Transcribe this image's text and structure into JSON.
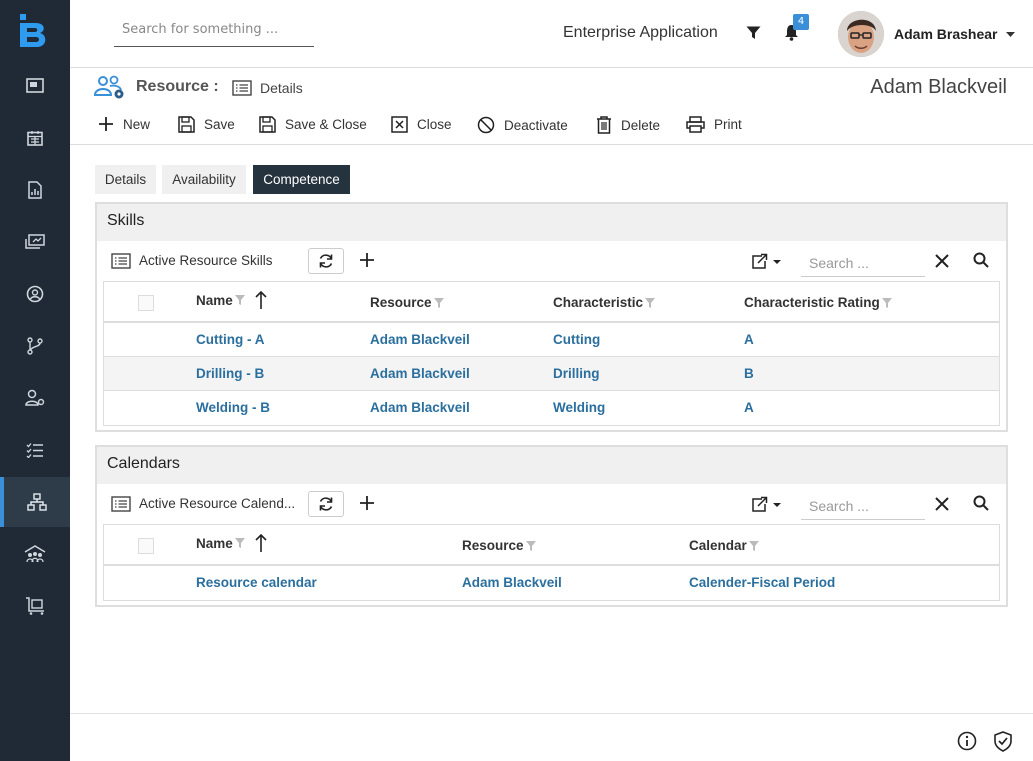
{
  "topbar": {
    "search_placeholder": "Search for something ...",
    "app_name": "Enterprise Application",
    "notification_count": "4",
    "user_name": "Adam Brashear"
  },
  "titlebar": {
    "entity_label": "Resource :",
    "view_label": "Details",
    "record_name": "Adam Blackveil"
  },
  "toolbar": {
    "new": "New",
    "save": "Save",
    "save_close": "Save & Close",
    "close": "Close",
    "deactivate": "Deactivate",
    "delete": "Delete",
    "print": "Print"
  },
  "tabs": [
    "Details",
    "Availability",
    "Competence"
  ],
  "skills": {
    "title": "Skills",
    "view_name": "Active Resource Skills",
    "search_placeholder": "Search ...",
    "columns": [
      "Name",
      "Resource",
      "Characteristic",
      "Characteristic Rating"
    ],
    "rows": [
      [
        "Cutting - A",
        "Adam Blackveil",
        "Cutting",
        "A"
      ],
      [
        "Drilling - B",
        "Adam Blackveil",
        "Drilling",
        "B"
      ],
      [
        "Welding - B",
        "Adam Blackveil",
        "Welding",
        "A"
      ]
    ]
  },
  "calendars": {
    "title": "Calendars",
    "view_name": "Active Resource Calend...",
    "search_placeholder": "Search ...",
    "columns": [
      "Name",
      "Resource",
      "Calendar"
    ],
    "rows": [
      [
        "Resource calendar",
        "Adam Blackveil",
        "Calender-Fiscal Period"
      ]
    ]
  },
  "colors": {
    "sidebar": "#1f2a36",
    "accent": "#3a8fd9",
    "link": "#2a6f9e",
    "active_tab": "#25333f"
  }
}
